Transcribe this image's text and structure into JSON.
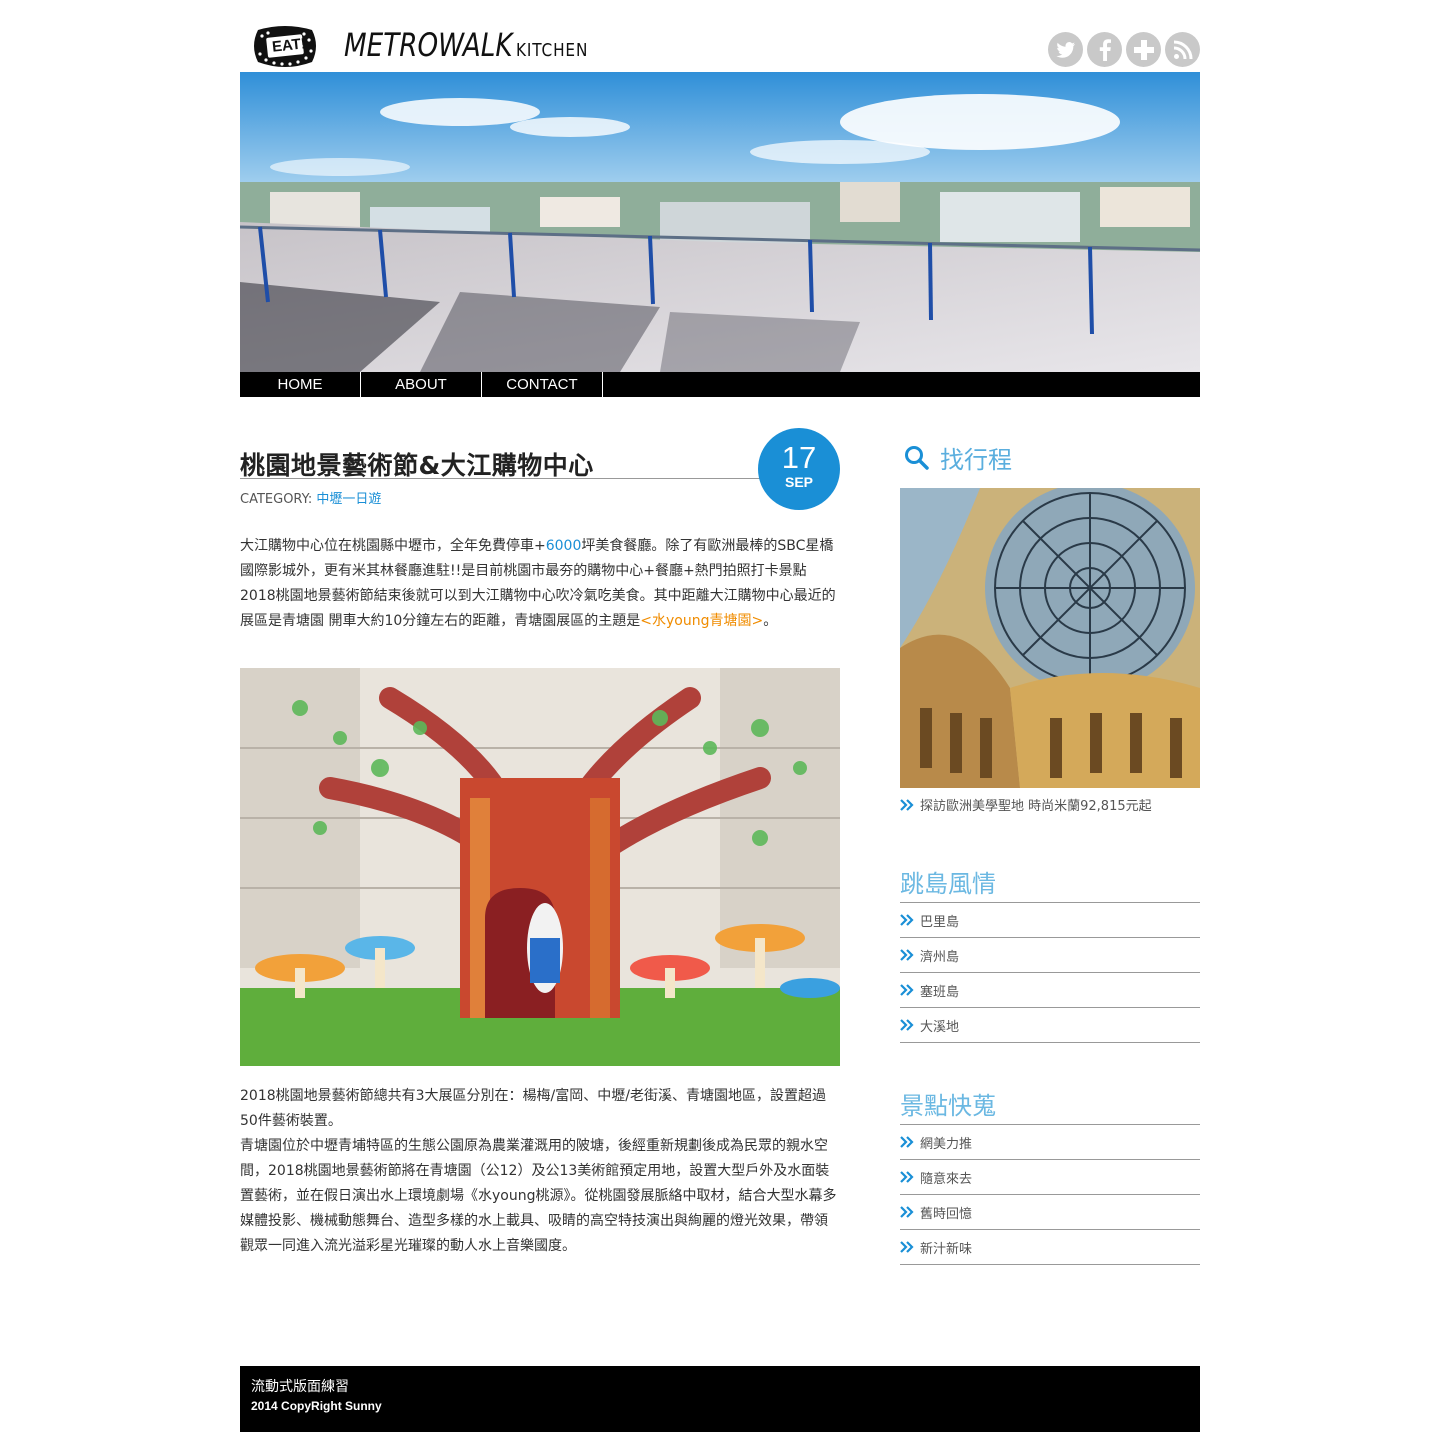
{
  "header": {
    "logo_badge": "EAT!",
    "brand_main": "METROWALK",
    "brand_sub": "KITCHEN",
    "social_icons": [
      "twitter-icon",
      "facebook-icon",
      "google-plus-icon",
      "rss-icon"
    ]
  },
  "nav": {
    "items": [
      "HOME",
      "ABOUT",
      "CONTACT"
    ]
  },
  "post": {
    "title": "桃園地景藝術節&大江購物中心",
    "date_day": "17",
    "date_month": "SEP",
    "category_label": "CATEGORY:",
    "category_value": "中壢一日遊",
    "para1_a": "大江購物中心位在桃園縣中壢市，全年免費停車+",
    "para1_num": "6000",
    "para1_b": "坪美食餐廳。除了有歐洲最棒的SBC星橋國際影城外，更有米其林餐廳進駐!!是目前桃園市最夯的購物中心+餐廳+熱門拍照打卡景點2018桃園地景藝術節結束後就可以到大江購物中心吹冷氣吃美食。其中距離大江購物中心最近的展區是青塘園 開車大約10分鐘左右的距離，青塘園展區的主題是",
    "para1_theme": "<水young青塘園>",
    "para1_end": "。",
    "para2_a": "2018桃園地景藝術節總共有3大展區分別在：楊梅/富岡、中壢/老街溪、青塘園地區，設置超過50件藝術裝置。",
    "para2_b": "青塘園位於中壢青埔特區的生態公園原為農業灌溉用的陂塘，後經重新規劃後成為民眾的親水空間，2018桃園地景藝術節將在青塘園（公12）及公13美術館預定用地，設置大型戶外及水面裝置藝術，並在假日演出水上環境劇場《水young桃源》。從桃園發展脈絡中取材，結合大型水幕多媒體投影、機械動態舞台、造型多樣的水上載具、吸睛的高空特技演出與絢麗的燈光效果，帶領觀眾一同進入流光溢彩星光璀璨的動人水上音樂國度。"
  },
  "sidebar": {
    "search_label": "找行程",
    "promo_caption": "探訪歐洲美學聖地 時尚米蘭92,815元起",
    "widgets": [
      {
        "title": "跳島風情",
        "items": [
          "巴里島",
          "濟州島",
          "塞班島",
          "大溪地"
        ]
      },
      {
        "title": "景點快蒐",
        "items": [
          "網美力推",
          "隨意來去",
          "舊時回憶",
          "新汁新味"
        ]
      }
    ]
  },
  "footer": {
    "title": "流動式版面練習",
    "copyright": "2014 CopyRight Sunny"
  },
  "colors": {
    "accent": "#1a8fd6",
    "widget_title": "#6bb8e2",
    "highlight_orange": "#f08c00",
    "nav_bg": "#000000"
  }
}
